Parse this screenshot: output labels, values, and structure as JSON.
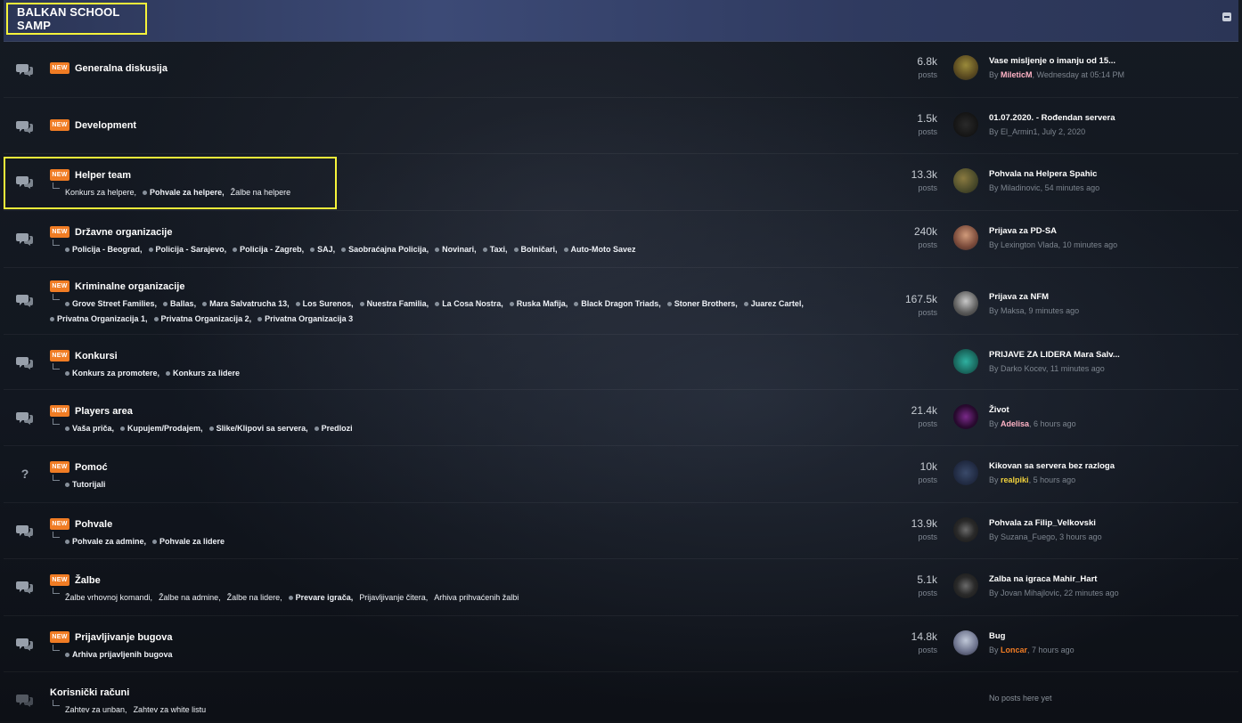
{
  "header": {
    "title": "BALKAN SCHOOL SAMP"
  },
  "rows": [
    {
      "title": "Generalna diskusija",
      "new": "NEW",
      "icon": "chat-bubbles-icon",
      "subforums": [],
      "stat": "6.8k",
      "stat_label": "posts",
      "last_title": "Vase misljenje o imanju od 15...",
      "by": "By",
      "user": "MileticM",
      "user_color": "#ffb3c6",
      "time": ", Wednesday at 05:14 PM"
    },
    {
      "title": "Development",
      "new": "NEW",
      "icon": "chat-bubbles-icon",
      "subforums": [],
      "stat": "1.5k",
      "stat_label": "posts",
      "last_title": "01.07.2020. - Rođendan servera",
      "by": "By",
      "user": "El_Armin1",
      "user_color": "#7d858f",
      "time": ", July 2, 2020"
    },
    {
      "title": "Helper team",
      "new": "NEW",
      "icon": "chat-bubbles-icon",
      "subforums": [
        {
          "label": "Konkurs za helpere,",
          "bold": false,
          "dot": false
        },
        {
          "label": "Pohvale za helpere,",
          "bold": true,
          "dot": true
        },
        {
          "label": "Žalbe na helpere",
          "bold": false,
          "dot": false
        }
      ],
      "stat": "13.3k",
      "stat_label": "posts",
      "last_title": "Pohvala na Helpera Spahic",
      "by": "By",
      "user": "Miladinovic",
      "user_color": "#7d858f",
      "time": ", 54 minutes ago"
    },
    {
      "title": "Državne organizacije",
      "new": "NEW",
      "icon": "chat-bubbles-icon",
      "subforums": [
        {
          "label": "Policija - Beograd,",
          "bold": true,
          "dot": true
        },
        {
          "label": "Policija - Sarajevo,",
          "bold": true,
          "dot": true
        },
        {
          "label": "Policija - Zagreb,",
          "bold": true,
          "dot": true
        },
        {
          "label": "SAJ,",
          "bold": true,
          "dot": true
        },
        {
          "label": "Saobraćajna Policija,",
          "bold": true,
          "dot": true
        },
        {
          "label": "Novinari,",
          "bold": true,
          "dot": true
        },
        {
          "label": "Taxi,",
          "bold": true,
          "dot": true
        },
        {
          "label": "Bolničari,",
          "bold": true,
          "dot": true
        },
        {
          "label": "Auto-Moto Savez",
          "bold": true,
          "dot": true
        }
      ],
      "stat": "240k",
      "stat_label": "posts",
      "last_title": "Prijava za PD-SA",
      "by": "By",
      "user": "Lexington Vlada",
      "user_color": "#7d858f",
      "time": ", 10 minutes ago"
    },
    {
      "title": "Kriminalne organizacije",
      "new": "NEW",
      "icon": "chat-bubbles-icon",
      "subforums": [
        {
          "label": "Grove Street Families,",
          "bold": true,
          "dot": true
        },
        {
          "label": "Ballas,",
          "bold": true,
          "dot": true
        },
        {
          "label": "Mara Salvatrucha 13,",
          "bold": true,
          "dot": true
        },
        {
          "label": "Los Surenos,",
          "bold": true,
          "dot": true
        },
        {
          "label": "Nuestra Familia,",
          "bold": true,
          "dot": true
        },
        {
          "label": "La Cosa Nostra,",
          "bold": true,
          "dot": true
        },
        {
          "label": "Ruska Mafija,",
          "bold": true,
          "dot": true
        },
        {
          "label": "Black Dragon Triads,",
          "bold": true,
          "dot": true
        },
        {
          "label": "Stoner Brothers,",
          "bold": true,
          "dot": true
        },
        {
          "label": "Juarez Cartel,",
          "bold": true,
          "dot": true
        },
        {
          "label": "Privatna Organizacija 1,",
          "bold": true,
          "dot": true
        },
        {
          "label": "Privatna Organizacija 2,",
          "bold": true,
          "dot": true
        },
        {
          "label": "Privatna Organizacija 3",
          "bold": true,
          "dot": true
        }
      ],
      "stat": "167.5k",
      "stat_label": "posts",
      "last_title": "Prijava za NFM",
      "by": "By",
      "user": "Maksa",
      "user_color": "#7d858f",
      "time": ", 9 minutes ago"
    },
    {
      "title": "Konkursi",
      "new": "NEW",
      "icon": "chat-bubbles-icon",
      "subforums": [
        {
          "label": "Konkurs za promotere,",
          "bold": true,
          "dot": true
        },
        {
          "label": "Konkurs za lidere",
          "bold": true,
          "dot": true
        }
      ],
      "stat": "",
      "stat_label": "",
      "last_title": "PRIJAVE ZA LIDERA Mara Salv...",
      "by": "By",
      "user": "Darko Kocev",
      "user_color": "#7d858f",
      "time": ", 11 minutes ago"
    },
    {
      "title": "Players area",
      "new": "NEW",
      "icon": "chat-bubbles-icon",
      "subforums": [
        {
          "label": "Vaša priča,",
          "bold": true,
          "dot": true
        },
        {
          "label": "Kupujem/Prodajem,",
          "bold": true,
          "dot": true
        },
        {
          "label": "Slike/Klipovi sa servera,",
          "bold": true,
          "dot": true
        },
        {
          "label": "Predlozi",
          "bold": true,
          "dot": true
        }
      ],
      "stat": "21.4k",
      "stat_label": "posts",
      "last_title": "Život",
      "by": "By",
      "user": "Adelisa",
      "user_color": "#ffb3c6",
      "time": ", 6 hours ago"
    },
    {
      "title": "Pomoć",
      "new": "NEW",
      "icon": "question-mark-icon",
      "subforums": [
        {
          "label": "Tutorijali",
          "bold": true,
          "dot": true
        }
      ],
      "stat": "10k",
      "stat_label": "posts",
      "last_title": "Kikovan sa servera bez razloga",
      "by": "By",
      "user": "realpiki",
      "user_color": "#f2d23c",
      "time": ", 5 hours ago"
    },
    {
      "title": "Pohvale",
      "new": "NEW",
      "icon": "chat-bubbles-icon",
      "subforums": [
        {
          "label": "Pohvale za admine,",
          "bold": true,
          "dot": true
        },
        {
          "label": "Pohvale za lidere",
          "bold": true,
          "dot": true
        }
      ],
      "stat": "13.9k",
      "stat_label": "posts",
      "last_title": "Pohvala za Filip_Velkovski",
      "by": "By",
      "user": "Suzana_Fuego",
      "user_color": "#7d858f",
      "time": ", 3 hours ago"
    },
    {
      "title": "Žalbe",
      "new": "NEW",
      "icon": "chat-bubbles-icon",
      "subforums": [
        {
          "label": "Žalbe vrhovnoj komandi,",
          "bold": false,
          "dot": false
        },
        {
          "label": "Žalbe na admine,",
          "bold": false,
          "dot": false
        },
        {
          "label": "Žalbe na lidere,",
          "bold": false,
          "dot": false
        },
        {
          "label": "Prevare igrača,",
          "bold": true,
          "dot": true
        },
        {
          "label": "Prijavljivanje čitera,",
          "bold": false,
          "dot": false
        },
        {
          "label": "Arhiva prihvaćenih žalbi",
          "bold": false,
          "dot": false
        }
      ],
      "stat": "5.1k",
      "stat_label": "posts",
      "last_title": "Zalba na igraca Mahir_Hart",
      "by": "By",
      "user": "Jovan Mihajlovic",
      "user_color": "#7d858f",
      "time": ", 22 minutes ago"
    },
    {
      "title": "Prijavljivanje bugova",
      "new": "NEW",
      "icon": "chat-bubbles-icon",
      "subforums": [
        {
          "label": "Arhiva prijavljenih bugova",
          "bold": true,
          "dot": true
        }
      ],
      "stat": "14.8k",
      "stat_label": "posts",
      "last_title": "Bug",
      "by": "By",
      "user": "Loncar",
      "user_color": "#f07c24",
      "time": ", 7 hours ago"
    },
    {
      "title": "Korisnički računi",
      "new": "",
      "icon": "chat-bubbles-icon",
      "subforums": [
        {
          "label": "Zahtev za unban,",
          "bold": false,
          "dot": false
        },
        {
          "label": "Zahtev za white listu",
          "bold": false,
          "dot": false
        }
      ],
      "stat": "",
      "stat_label": "",
      "last_title": "",
      "by": "",
      "user": "",
      "user_color": "#7d858f",
      "time": "",
      "no_posts": "No posts here yet"
    }
  ]
}
